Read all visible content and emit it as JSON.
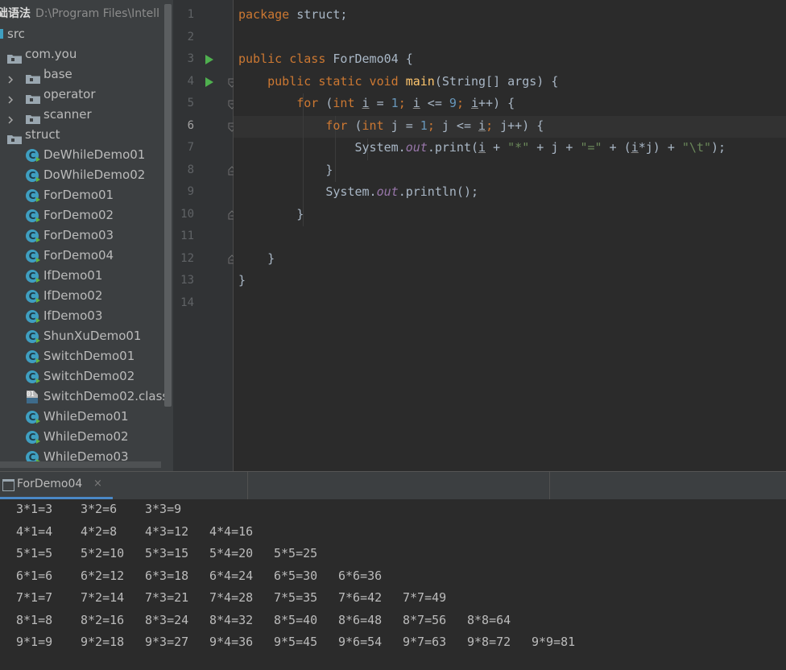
{
  "project": {
    "title_bold": "础语法",
    "title_path": "D:\\Program Files\\Intell",
    "tree": [
      {
        "label": "src",
        "kind": "src"
      },
      {
        "label": "com.you",
        "kind": "pkg"
      },
      {
        "label": "base",
        "kind": "pkg"
      },
      {
        "label": "operator",
        "kind": "pkg"
      },
      {
        "label": "scanner",
        "kind": "pkg"
      },
      {
        "label": "struct",
        "kind": "pkg"
      },
      {
        "label": "DeWhileDemo01",
        "kind": "class"
      },
      {
        "label": "DoWhileDemo02",
        "kind": "class"
      },
      {
        "label": "ForDemo01",
        "kind": "class"
      },
      {
        "label": "ForDemo02",
        "kind": "class"
      },
      {
        "label": "ForDemo03",
        "kind": "class"
      },
      {
        "label": "ForDemo04",
        "kind": "class"
      },
      {
        "label": "IfDemo01",
        "kind": "class"
      },
      {
        "label": "IfDemo02",
        "kind": "class"
      },
      {
        "label": "IfDemo03",
        "kind": "class"
      },
      {
        "label": "ShunXuDemo01",
        "kind": "class"
      },
      {
        "label": "SwitchDemo01",
        "kind": "class"
      },
      {
        "label": "SwitchDemo02",
        "kind": "class"
      },
      {
        "label": "SwitchDemo02.class",
        "kind": "classfile"
      },
      {
        "label": "WhileDemo01",
        "kind": "class"
      },
      {
        "label": "WhileDemo02",
        "kind": "class"
      },
      {
        "label": "WhileDemo03",
        "kind": "class"
      }
    ],
    "class_icon_letter": "C",
    "classfile_icon_text": "01"
  },
  "editor": {
    "line_numbers": [
      "1",
      "2",
      "3",
      "4",
      "5",
      "6",
      "7",
      "8",
      "9",
      "10",
      "11",
      "12",
      "13",
      "14"
    ],
    "current_line": "6",
    "code": {
      "pkg": "package",
      "pkg_name": " struct;",
      "public": "public",
      "class": " class ",
      "classname": "ForDemo04 {",
      "static": " static void ",
      "main": "main",
      "args": "(String[] args) {",
      "for": "for",
      "paren": " (",
      "int": "int",
      "i": "i",
      "j": "j",
      "eq": " = ",
      "one": "1",
      "semi": "; ",
      "le": " <= ",
      "nine": "9",
      "inc_i": "++) {",
      "inc_j": "++) {",
      "system": "System.",
      "out": "out",
      "print": ".print(",
      "println": ".println();",
      "plus": " + ",
      "star": "\"*\"",
      "equals": "\"=\"",
      "tab": "\"\\t\"",
      "open": "(",
      "mul": "*",
      "close_end": ");",
      "close_paren": ") + ",
      "brace": "}"
    }
  },
  "run": {
    "tab_label": "ForDemo04",
    "tab_close": "×",
    "output": [
      [
        "3*1=3",
        "3*2=6",
        "3*3=9"
      ],
      [
        "4*1=4",
        "4*2=8",
        "4*3=12",
        "4*4=16"
      ],
      [
        "5*1=5",
        "5*2=10",
        "5*3=15",
        "5*4=20",
        "5*5=25"
      ],
      [
        "6*1=6",
        "6*2=12",
        "6*3=18",
        "6*4=24",
        "6*5=30",
        "6*6=36"
      ],
      [
        "7*1=7",
        "7*2=14",
        "7*3=21",
        "7*4=28",
        "7*5=35",
        "7*6=42",
        "7*7=49"
      ],
      [
        "8*1=8",
        "8*2=16",
        "8*3=24",
        "8*4=32",
        "8*5=40",
        "8*6=48",
        "8*7=56",
        "8*8=64"
      ],
      [
        "9*1=9",
        "9*2=18",
        "9*3=27",
        "9*4=36",
        "9*5=45",
        "9*6=54",
        "9*7=63",
        "9*8=72",
        "9*9=81"
      ]
    ]
  },
  "colors": {
    "keyword": "#cc7832",
    "number": "#6897bb",
    "string": "#6a8759",
    "method": "#ffc66d",
    "static_field": "#9876aa",
    "run_icon": "#4fb04f",
    "class_icon": "#3f9fc1",
    "tab_underline": "#4a88c7"
  }
}
